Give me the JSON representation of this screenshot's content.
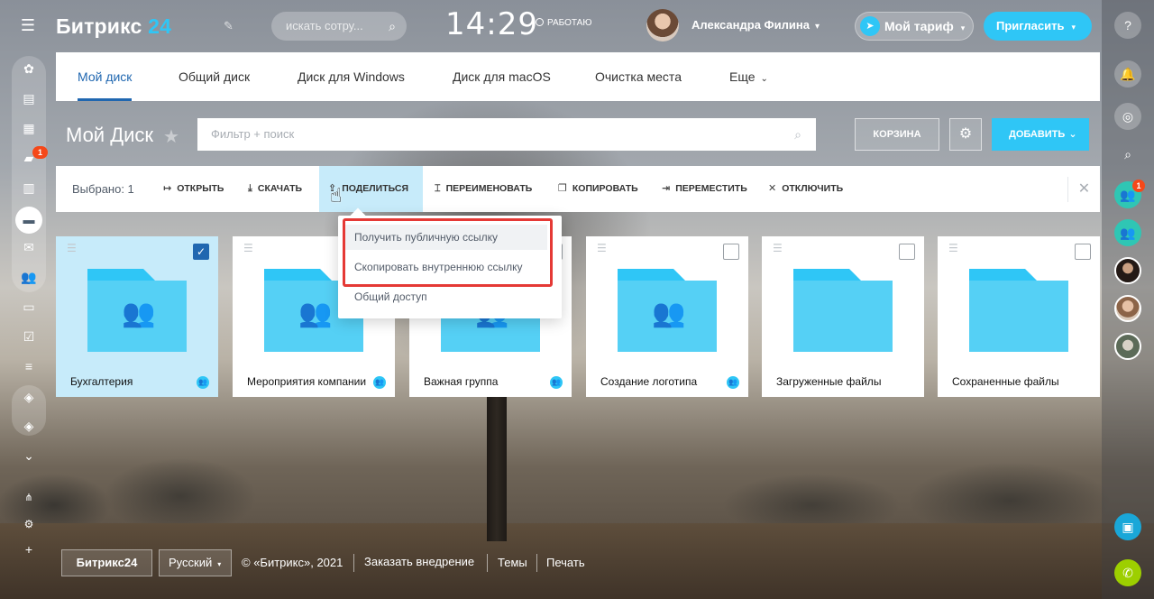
{
  "header": {
    "logo_text": "Битрикс",
    "logo_num": "24",
    "search_placeholder": "искать сотру...",
    "clock": "14:29",
    "work_status": "РАБОТАЮ",
    "user_name": "Александра Филина",
    "tariff_label": "Мой тариф",
    "invite_label": "Пригласить"
  },
  "left_rail": {
    "chat_badge": "1"
  },
  "right_rail": {
    "group_badge": "1"
  },
  "tabs": [
    {
      "label": "Мой диск",
      "active": true
    },
    {
      "label": "Общий диск"
    },
    {
      "label": "Диск для Windows"
    },
    {
      "label": "Диск для macOS"
    },
    {
      "label": "Очистка места"
    },
    {
      "label": "Еще"
    }
  ],
  "title_row": {
    "title": "Мой Диск",
    "filter_placeholder": "Фильтр + поиск",
    "trash_label": "КОРЗИНА",
    "add_label": "ДОБАВИТЬ"
  },
  "action_bar": {
    "selected": "Выбрано: 1",
    "actions": [
      {
        "label": "ОТКРЫТЬ",
        "icon": "open-icon"
      },
      {
        "label": "СКАЧАТЬ",
        "icon": "download-icon"
      },
      {
        "label": "ПОДЕЛИТЬСЯ",
        "icon": "share-icon",
        "active": true
      },
      {
        "label": "ПЕРЕИМЕНОВАТЬ",
        "icon": "rename-icon"
      },
      {
        "label": "КОПИРОВАТЬ",
        "icon": "copy-icon"
      },
      {
        "label": "ПЕРЕМЕСТИТЬ",
        "icon": "move-icon"
      },
      {
        "label": "ОТКЛЮЧИТЬ",
        "icon": "disconnect-icon"
      }
    ]
  },
  "share_menu": {
    "items": [
      "Получить публичную ссылку",
      "Скопировать внутреннюю ссылку",
      "Общий доступ"
    ],
    "highlight_color": "#e53935"
  },
  "folders": [
    {
      "name": "Бухгалтерия",
      "shared": true,
      "people": true,
      "checked": true
    },
    {
      "name": "Мероприятия компании",
      "shared": true,
      "people": true,
      "checked": false
    },
    {
      "name": "Важная группа",
      "shared": true,
      "people": true,
      "checked": false
    },
    {
      "name": "Создание логотипа",
      "shared": true,
      "people": true,
      "checked": false
    },
    {
      "name": "Загруженные файлы",
      "shared": false,
      "people": false,
      "checked": false
    },
    {
      "name": "Сохраненные файлы",
      "shared": false,
      "people": false,
      "checked": false
    }
  ],
  "footer": {
    "logo": "Битрикс24",
    "language": "Русский",
    "copyright": "© «Битрикс», 2021",
    "order": "Заказать внедрение",
    "themes": "Темы",
    "print": "Печать"
  },
  "colors": {
    "accent": "#2fc6f6",
    "tab_active": "#2067b0",
    "selected_card": "#c7ebfa",
    "badge": "#f54819"
  }
}
